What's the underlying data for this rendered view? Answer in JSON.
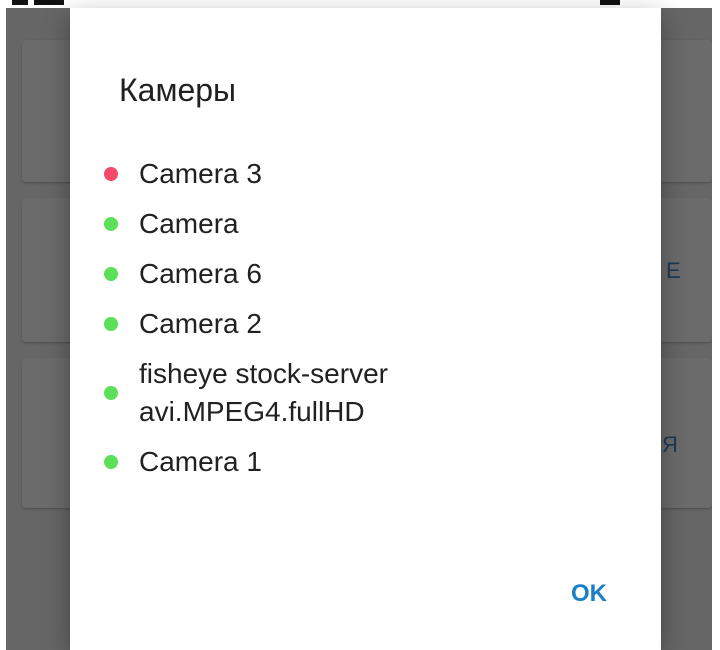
{
  "dialog": {
    "title": "Камеры",
    "ok_label": "OK"
  },
  "cameras": [
    {
      "name": "Camera 3",
      "status_color": "#f24b6a"
    },
    {
      "name": "Camera",
      "status_color": "#5ce05a"
    },
    {
      "name": "Camera 6",
      "status_color": "#5ce05a"
    },
    {
      "name": "Camera 2",
      "status_color": "#5ce05a"
    },
    {
      "name": "fisheye stock-server\navi.MPEG4.fullHD",
      "status_color": "#5ce05a"
    },
    {
      "name": "Camera 1",
      "status_color": "#5ce05a"
    }
  ],
  "background": {
    "card_2_text_fragment": "E",
    "card_3_text_fragment": "Я"
  },
  "colors": {
    "accent": "#1a7fc8",
    "scrim": "#666666",
    "online": "#5ce05a",
    "offline": "#f24b6a"
  }
}
